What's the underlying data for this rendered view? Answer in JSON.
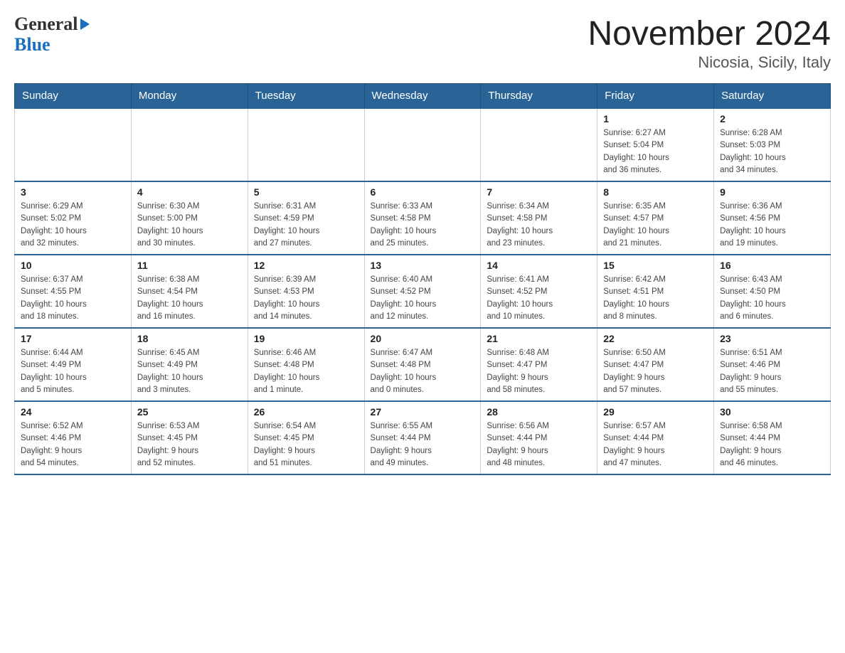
{
  "header": {
    "logo_line1": "General",
    "logo_line2": "Blue",
    "title": "November 2024",
    "subtitle": "Nicosia, Sicily, Italy"
  },
  "weekdays": [
    "Sunday",
    "Monday",
    "Tuesday",
    "Wednesday",
    "Thursday",
    "Friday",
    "Saturday"
  ],
  "weeks": [
    [
      {
        "day": "",
        "info": ""
      },
      {
        "day": "",
        "info": ""
      },
      {
        "day": "",
        "info": ""
      },
      {
        "day": "",
        "info": ""
      },
      {
        "day": "",
        "info": ""
      },
      {
        "day": "1",
        "info": "Sunrise: 6:27 AM\nSunset: 5:04 PM\nDaylight: 10 hours\nand 36 minutes."
      },
      {
        "day": "2",
        "info": "Sunrise: 6:28 AM\nSunset: 5:03 PM\nDaylight: 10 hours\nand 34 minutes."
      }
    ],
    [
      {
        "day": "3",
        "info": "Sunrise: 6:29 AM\nSunset: 5:02 PM\nDaylight: 10 hours\nand 32 minutes."
      },
      {
        "day": "4",
        "info": "Sunrise: 6:30 AM\nSunset: 5:00 PM\nDaylight: 10 hours\nand 30 minutes."
      },
      {
        "day": "5",
        "info": "Sunrise: 6:31 AM\nSunset: 4:59 PM\nDaylight: 10 hours\nand 27 minutes."
      },
      {
        "day": "6",
        "info": "Sunrise: 6:33 AM\nSunset: 4:58 PM\nDaylight: 10 hours\nand 25 minutes."
      },
      {
        "day": "7",
        "info": "Sunrise: 6:34 AM\nSunset: 4:58 PM\nDaylight: 10 hours\nand 23 minutes."
      },
      {
        "day": "8",
        "info": "Sunrise: 6:35 AM\nSunset: 4:57 PM\nDaylight: 10 hours\nand 21 minutes."
      },
      {
        "day": "9",
        "info": "Sunrise: 6:36 AM\nSunset: 4:56 PM\nDaylight: 10 hours\nand 19 minutes."
      }
    ],
    [
      {
        "day": "10",
        "info": "Sunrise: 6:37 AM\nSunset: 4:55 PM\nDaylight: 10 hours\nand 18 minutes."
      },
      {
        "day": "11",
        "info": "Sunrise: 6:38 AM\nSunset: 4:54 PM\nDaylight: 10 hours\nand 16 minutes."
      },
      {
        "day": "12",
        "info": "Sunrise: 6:39 AM\nSunset: 4:53 PM\nDaylight: 10 hours\nand 14 minutes."
      },
      {
        "day": "13",
        "info": "Sunrise: 6:40 AM\nSunset: 4:52 PM\nDaylight: 10 hours\nand 12 minutes."
      },
      {
        "day": "14",
        "info": "Sunrise: 6:41 AM\nSunset: 4:52 PM\nDaylight: 10 hours\nand 10 minutes."
      },
      {
        "day": "15",
        "info": "Sunrise: 6:42 AM\nSunset: 4:51 PM\nDaylight: 10 hours\nand 8 minutes."
      },
      {
        "day": "16",
        "info": "Sunrise: 6:43 AM\nSunset: 4:50 PM\nDaylight: 10 hours\nand 6 minutes."
      }
    ],
    [
      {
        "day": "17",
        "info": "Sunrise: 6:44 AM\nSunset: 4:49 PM\nDaylight: 10 hours\nand 5 minutes."
      },
      {
        "day": "18",
        "info": "Sunrise: 6:45 AM\nSunset: 4:49 PM\nDaylight: 10 hours\nand 3 minutes."
      },
      {
        "day": "19",
        "info": "Sunrise: 6:46 AM\nSunset: 4:48 PM\nDaylight: 10 hours\nand 1 minute."
      },
      {
        "day": "20",
        "info": "Sunrise: 6:47 AM\nSunset: 4:48 PM\nDaylight: 10 hours\nand 0 minutes."
      },
      {
        "day": "21",
        "info": "Sunrise: 6:48 AM\nSunset: 4:47 PM\nDaylight: 9 hours\nand 58 minutes."
      },
      {
        "day": "22",
        "info": "Sunrise: 6:50 AM\nSunset: 4:47 PM\nDaylight: 9 hours\nand 57 minutes."
      },
      {
        "day": "23",
        "info": "Sunrise: 6:51 AM\nSunset: 4:46 PM\nDaylight: 9 hours\nand 55 minutes."
      }
    ],
    [
      {
        "day": "24",
        "info": "Sunrise: 6:52 AM\nSunset: 4:46 PM\nDaylight: 9 hours\nand 54 minutes."
      },
      {
        "day": "25",
        "info": "Sunrise: 6:53 AM\nSunset: 4:45 PM\nDaylight: 9 hours\nand 52 minutes."
      },
      {
        "day": "26",
        "info": "Sunrise: 6:54 AM\nSunset: 4:45 PM\nDaylight: 9 hours\nand 51 minutes."
      },
      {
        "day": "27",
        "info": "Sunrise: 6:55 AM\nSunset: 4:44 PM\nDaylight: 9 hours\nand 49 minutes."
      },
      {
        "day": "28",
        "info": "Sunrise: 6:56 AM\nSunset: 4:44 PM\nDaylight: 9 hours\nand 48 minutes."
      },
      {
        "day": "29",
        "info": "Sunrise: 6:57 AM\nSunset: 4:44 PM\nDaylight: 9 hours\nand 47 minutes."
      },
      {
        "day": "30",
        "info": "Sunrise: 6:58 AM\nSunset: 4:44 PM\nDaylight: 9 hours\nand 46 minutes."
      }
    ]
  ]
}
